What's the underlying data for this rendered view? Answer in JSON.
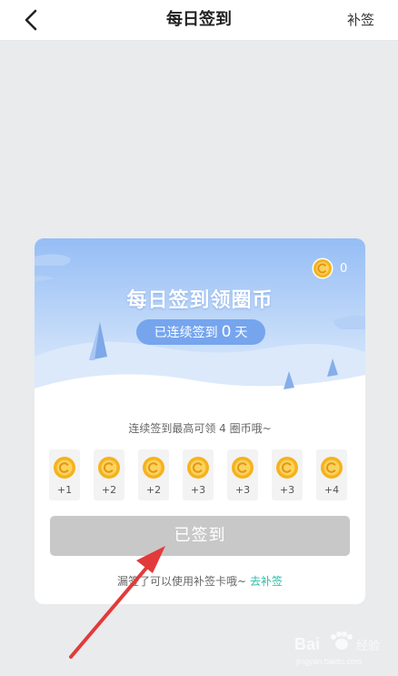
{
  "header": {
    "title": "每日签到",
    "right_action": "补签"
  },
  "card": {
    "coin_count": "0",
    "banner_title": "每日签到领圈币",
    "streak": {
      "prefix": "已连续签到",
      "days": "0",
      "suffix": "天"
    },
    "hint": "连续签到最高可领 4 圈币哦~",
    "days": [
      {
        "reward": "+1"
      },
      {
        "reward": "+2"
      },
      {
        "reward": "+2"
      },
      {
        "reward": "+3"
      },
      {
        "reward": "+3"
      },
      {
        "reward": "+3"
      },
      {
        "reward": "+4"
      }
    ],
    "signed_button": "已签到",
    "footer_hint": "漏签了可以使用补签卡哦~",
    "footer_link": "去补签"
  },
  "watermark": {
    "text": "Baidu 经验",
    "subtext": "jingyan.baidu.com"
  },
  "colors": {
    "banner_top": "#9ec2f6",
    "banner_bottom": "#eaf3fd",
    "pill": "#76a5ee",
    "coin_gold": "#f6b21c",
    "button_disabled": "#c8c8c8",
    "link": "#2dbca6",
    "annotation_arrow": "#e23a3a"
  }
}
